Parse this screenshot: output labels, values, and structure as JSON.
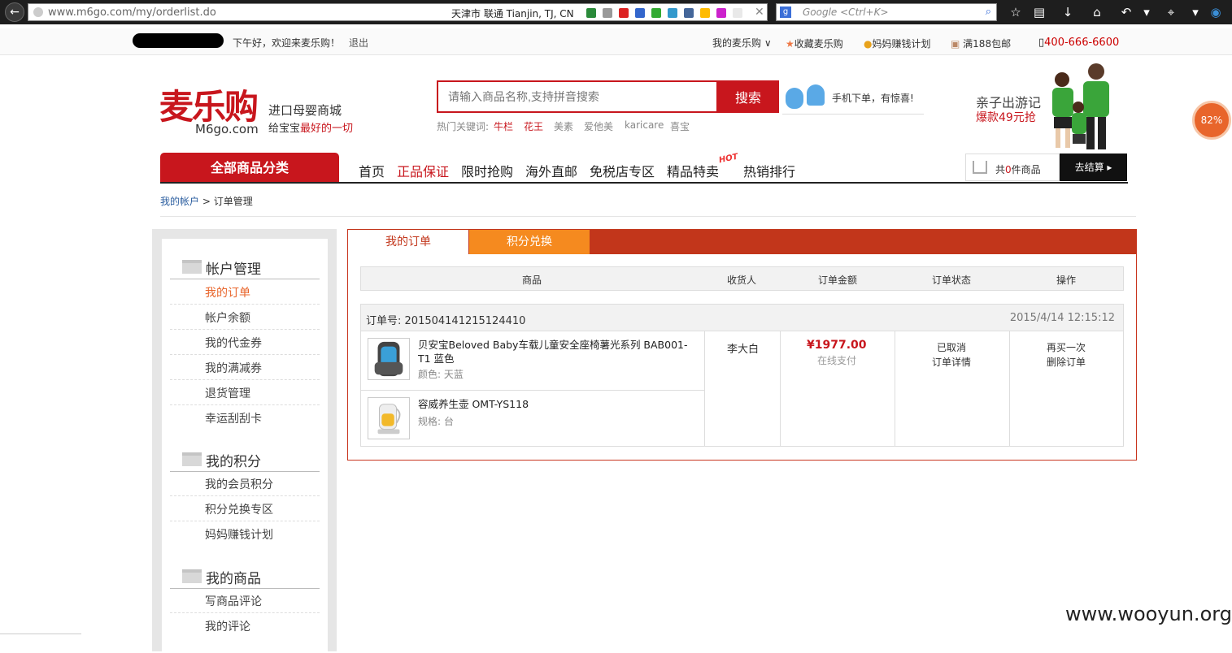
{
  "browser": {
    "url": "www.m6go.com/my/orderlist.do",
    "geo": "天津市 联通    Tianjin, TJ, CN",
    "search_placeholder": "Google <Ctrl+K>"
  },
  "topbar": {
    "greeting": "下午好，欢迎来麦乐购！",
    "logout": "退出",
    "my_m6go": "我的麦乐购 ∨",
    "favorite": "收藏麦乐购",
    "mama_plan": "妈妈赚钱计划",
    "free_ship": "满188包邮",
    "phone": "400-666-6600"
  },
  "header": {
    "logo_cn": "麦乐购",
    "logo_en": "M6go.com",
    "slogan1": "进口母婴商城",
    "slogan2_prefix": "给宝宝",
    "slogan2_highlight": "最好的一切",
    "search_placeholder": "请输入商品名称,支持拼音搜索",
    "search_button": "搜索",
    "hot_label": "热门关键词:",
    "hot_keywords": [
      "牛栏",
      "花王",
      "美素",
      "爱他美",
      "karicare",
      "喜宝"
    ],
    "app_text": "手机下单，有惊喜!",
    "promo_title": "亲子出游记",
    "promo_sub": "爆款49元抢",
    "badge_percent": "82%"
  },
  "nav": {
    "all_categories": "全部商品分类",
    "items": [
      "首页",
      "正品保证",
      "限时抢购",
      "海外直邮",
      "免税店专区",
      "精品特卖",
      "热销排行"
    ],
    "hot_badge": "HOT",
    "cart_prefix": "共",
    "cart_count": "0",
    "cart_suffix": "件商品",
    "checkout": "去结算 ▸"
  },
  "breadcrumb": {
    "account": "我的帐户",
    "sep": " > ",
    "current": "订单管理"
  },
  "sidebar": {
    "sections": [
      {
        "title": "帐户管理",
        "links": [
          "我的订单",
          "帐户余额",
          "我的代金券",
          "我的满减券",
          "退货管理",
          "幸运刮刮卡"
        ]
      },
      {
        "title": "我的积分",
        "links": [
          "我的会员积分",
          "积分兑换专区",
          "妈妈赚钱计划"
        ]
      },
      {
        "title": "我的商品",
        "links": [
          "写商品评论",
          "我的评论"
        ]
      }
    ]
  },
  "tabs": {
    "orders": "我的订单",
    "points": "积分兑换"
  },
  "table": {
    "headers": [
      "商品",
      "收货人",
      "订单金额",
      "订单状态",
      "操作"
    ]
  },
  "order": {
    "number_label": "订单号:",
    "number": "201504141215124410",
    "time": "2015/4/14 12:15:12",
    "items": [
      {
        "name": "贝安宝Beloved Baby车载儿童安全座椅薯光系列 BAB001-T1 蓝色",
        "attr": "颜色: 天蓝"
      },
      {
        "name": "容威养生壶 OMT-YS118",
        "attr": "规格: 台"
      }
    ],
    "receiver": "李大白",
    "amount": "¥1977.00",
    "pay_type": "在线支付",
    "status": "已取消",
    "detail": "订单详情",
    "rebuy": "再买一次",
    "delete": "删除订单"
  },
  "watermark": "www.wooyun.org",
  "colors": {
    "brand_red": "#c8161d",
    "tab_red": "#c2361b",
    "tab_orange": "#f58a1f"
  }
}
